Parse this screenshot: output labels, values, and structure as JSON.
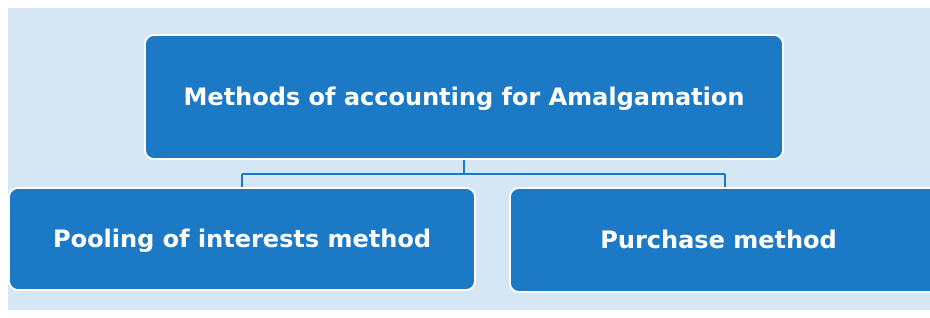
{
  "diagram": {
    "root": {
      "label": "Methods of accounting for Amalgamation"
    },
    "children": [
      {
        "label": "Pooling of interests method"
      },
      {
        "label": "Purchase method"
      }
    ]
  },
  "colors": {
    "background_panel": "#d5e6f4",
    "node_fill": "#1b79c6",
    "node_text": "#ffffff",
    "node_border": "#ffffff",
    "connector": "#1b79c6"
  }
}
